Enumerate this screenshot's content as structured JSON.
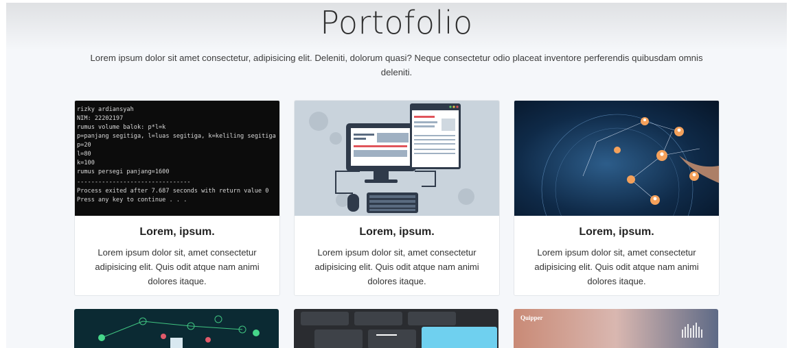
{
  "section": {
    "title": "Portofolio",
    "subtitle": "Lorem ipsum dolor sit amet consectetur, adipisicing elit. Deleniti, dolorum quasi? Neque consectetur odio placeat inventore perferendis quibusdam omnis deleniti."
  },
  "cards": [
    {
      "title": "Lorem, ipsum.",
      "text": "Lorem ipsum dolor sit, amet consectetur adipisicing elit. Quis odit atque nam animi dolores itaque.",
      "image": "terminal-screenshot",
      "terminal_lines": [
        "rizky ardiansyah",
        "NIM: 22202197",
        "rumus volume balok: p*l=k",
        "p=panjang segitiga, l=luas segitiga, k=keliling segitiga",
        "p=20",
        "l=80",
        "k=100",
        "rumus persegi panjang=1600",
        "--------------------------------",
        "Process exited after 7.687 seconds with return value 0",
        "Press any key to continue . . ."
      ]
    },
    {
      "title": "Lorem, ipsum.",
      "text": "Lorem ipsum dolor sit, amet consectetur adipisicing elit. Quis odit atque nam animi dolores itaque.",
      "image": "computer-illustration"
    },
    {
      "title": "Lorem, ipsum.",
      "text": "Lorem ipsum dolor sit, amet consectetur adipisicing elit. Quis odit atque nam animi dolores itaque.",
      "image": "global-network-photo"
    }
  ],
  "second_row": [
    {
      "image": "network-icons-photo"
    },
    {
      "image": "keyboard-photo"
    },
    {
      "image": "quipper-photo",
      "logo_text": "Quipper"
    }
  ],
  "colors": {
    "background": "#f5f7fa",
    "card_bg": "#ffffff",
    "terminal_bg": "#0c0c0c",
    "terminal_text": "#d9d9d9"
  }
}
